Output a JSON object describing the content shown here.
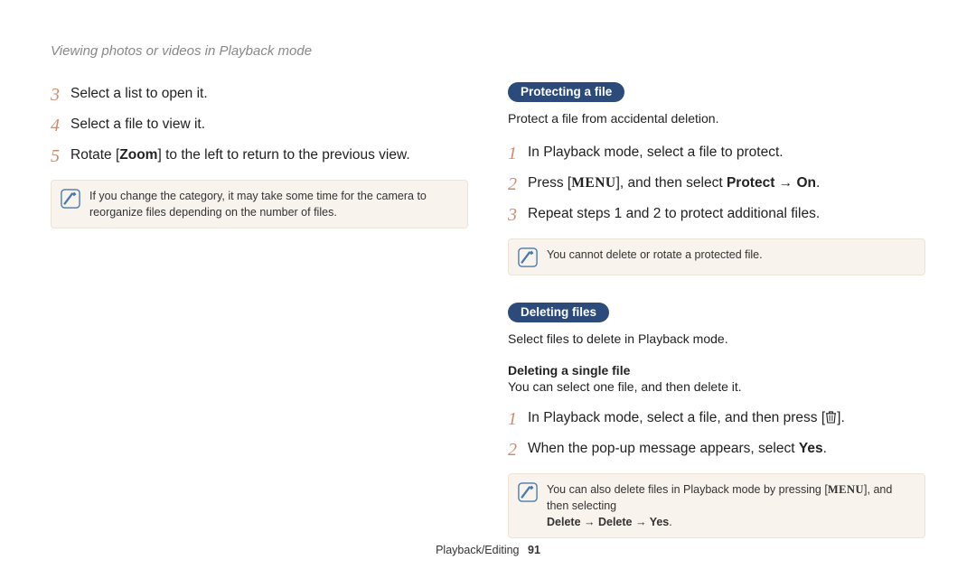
{
  "pageTitle": "Viewing photos or videos in Playback mode",
  "left": {
    "step3": {
      "num": "3",
      "text": "Select a list to open it."
    },
    "step4": {
      "num": "4",
      "text": "Select a file to view it."
    },
    "step5": {
      "num": "5",
      "pre": "Rotate [",
      "bold": "Zoom",
      "post": "] to the left to return to the previous view."
    },
    "note": "If you change the category, it may take some time for the camera to reorganize files depending on the number of files."
  },
  "right": {
    "protect": {
      "pill": "Protecting a file",
      "desc": "Protect a file from accidental deletion.",
      "step1": {
        "num": "1",
        "text": "In Playback mode, select a file to protect."
      },
      "step2": {
        "num": "2",
        "a": "Press [",
        "menu": "MENU",
        "b": "], and then select ",
        "bold": "Protect",
        "c": " → ",
        "bold2": "On",
        "d": "."
      },
      "step3": {
        "num": "3",
        "text": "Repeat steps 1 and 2 to protect additional files."
      },
      "note": "You cannot delete or rotate a protected file."
    },
    "delete": {
      "pill": "Deleting files",
      "desc": "Select files to delete in Playback mode.",
      "subhead": "Deleting a single file",
      "subdesc": "You can select one file, and then delete it.",
      "step1": {
        "num": "1",
        "a": "In Playback mode, select a file, and then press [",
        "b": "]."
      },
      "step2": {
        "num": "2",
        "a": "When the pop-up message appears, select ",
        "bold": "Yes",
        "b": "."
      },
      "note": {
        "a": "You can also delete files in Playback mode by pressing [",
        "menu": "MENU",
        "b": "], and then selecting ",
        "bold": "Delete → Delete → Yes",
        "c": "."
      }
    }
  },
  "footer": {
    "section": "Playback/Editing",
    "page": "91"
  }
}
